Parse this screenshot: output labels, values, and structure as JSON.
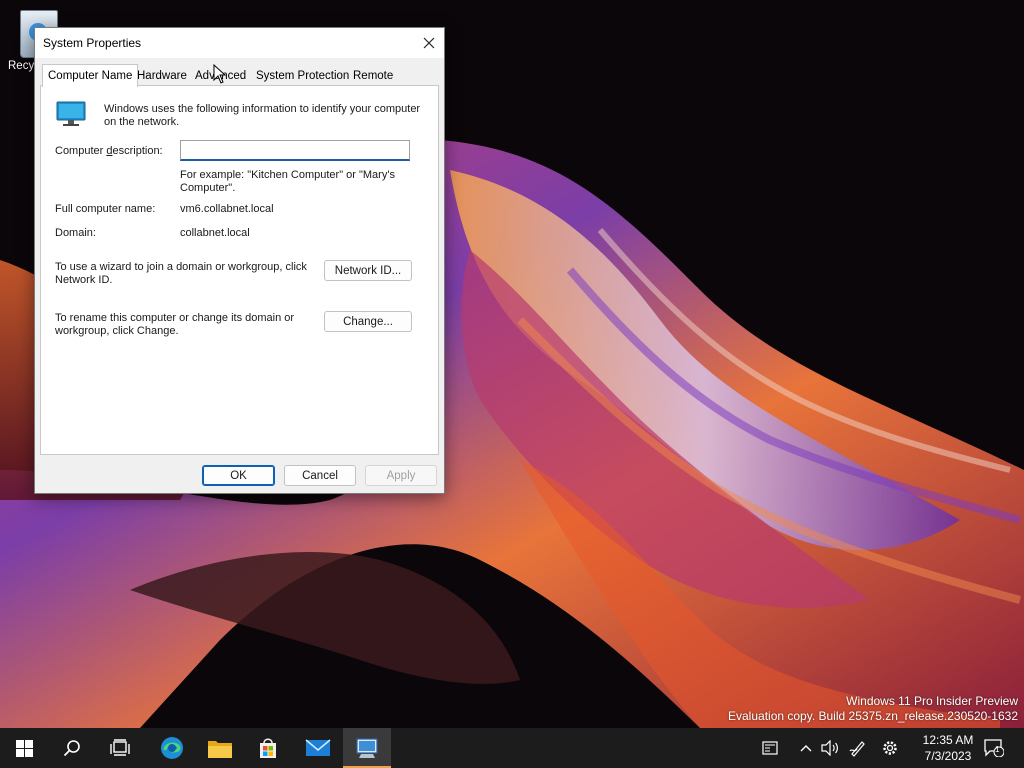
{
  "desktop": {
    "recycle_bin_label": "Recy"
  },
  "dialog": {
    "title": "System Properties",
    "tabs": [
      {
        "label": "Computer Name",
        "active": true
      },
      {
        "label": "Hardware",
        "active": false
      },
      {
        "label": "Advanced",
        "active": false
      },
      {
        "label": "System Protection",
        "active": false
      },
      {
        "label": "Remote",
        "active": false
      }
    ],
    "intro_line1": "Windows uses the following information to identify your computer",
    "intro_line2": "on the network.",
    "description_label": "Computer description:",
    "description_value": "",
    "example_line1": "For example: \"Kitchen Computer\" or \"Mary's",
    "example_line2": "Computer\".",
    "full_name_label": "Full computer name:",
    "full_name_value": "vm6.collabnet.local",
    "domain_label": "Domain:",
    "domain_value": "collabnet.local",
    "network_id_text_line1": "To use a wizard to join a domain or workgroup, click",
    "network_id_text_line2": "Network ID.",
    "network_id_button": "Network ID...",
    "change_text_line1": "To rename this computer or change its domain or",
    "change_text_line2": "workgroup, click Change.",
    "change_button": "Change...",
    "ok_button": "OK",
    "cancel_button": "Cancel",
    "apply_button": "Apply"
  },
  "watermark": {
    "line1": "Windows 11 Pro Insider Preview",
    "line2": "Evaluation copy. Build 25375.zn_release.230520-1632"
  },
  "taskbar": {
    "apps": [
      {
        "icon": "windows-start-icon"
      },
      {
        "icon": "search-icon"
      },
      {
        "icon": "task-view-icon"
      },
      {
        "icon": "edge-icon"
      },
      {
        "icon": "file-explorer-icon"
      },
      {
        "icon": "store-icon"
      },
      {
        "icon": "mail-icon"
      },
      {
        "icon": "system-properties-icon",
        "active": true
      }
    ],
    "time": "12:35 AM",
    "date": "7/3/2023",
    "notification_count": "1",
    "accent_color": "#f2a04a"
  },
  "colors": {
    "default_button_border": "#0f5fb8",
    "input_underline": "#1f5aa6"
  }
}
